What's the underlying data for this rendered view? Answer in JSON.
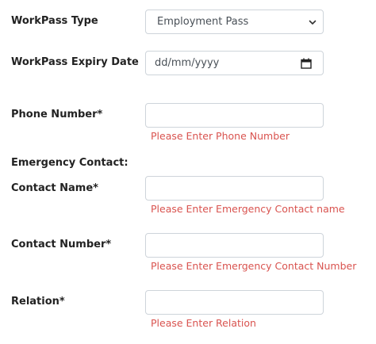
{
  "workpass_type": {
    "label": "WorkPass Type",
    "selected": "Employment Pass"
  },
  "workpass_expiry": {
    "label": "WorkPass Expiry Date",
    "placeholder": "dd/mm/yyyy"
  },
  "phone": {
    "label": "Phone Number*",
    "value": "",
    "error": "Please Enter Phone Number"
  },
  "emergency": {
    "section_label": "Emergency Contact:",
    "contact_name": {
      "label": "Contact Name*",
      "value": "",
      "error": "Please Enter Emergency Contact name"
    },
    "contact_number": {
      "label": "Contact Number*",
      "value": "",
      "error": "Please Enter Emergency Contact Number"
    },
    "relation": {
      "label": "Relation*",
      "value": "",
      "error": "Please Enter Relation"
    }
  },
  "colors": {
    "error": "#d9534f",
    "border": "#ced4da",
    "label": "#222222"
  }
}
